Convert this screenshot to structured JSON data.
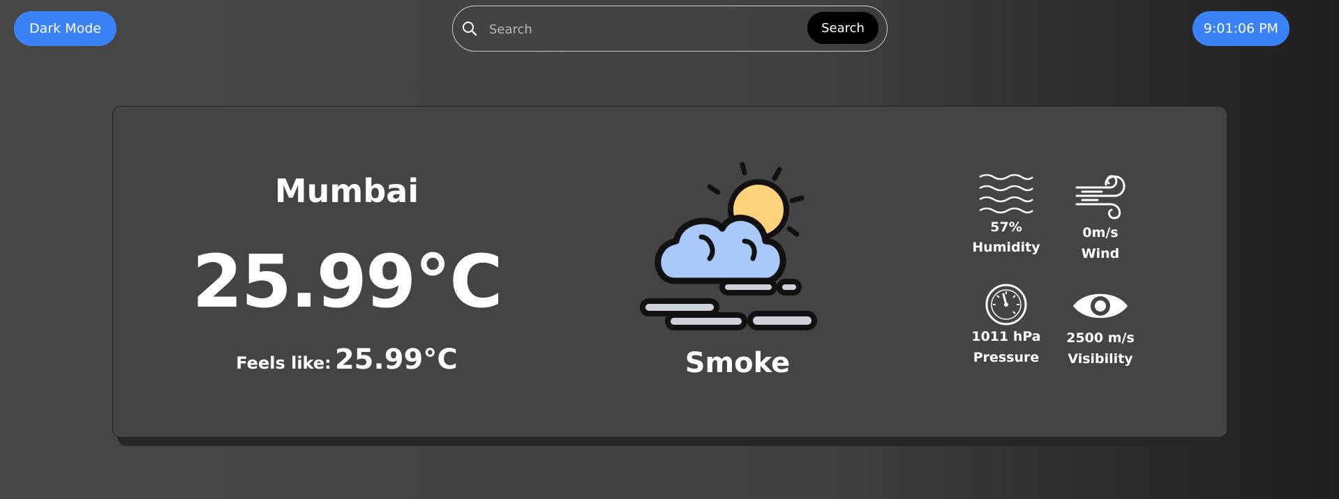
{
  "header": {
    "dark_mode_label": "Dark Mode",
    "search_placeholder": "Search",
    "search_button_label": "Search",
    "clock": "9:01:06 PM"
  },
  "weather": {
    "city": "Mumbai",
    "temperature": "25.99°C",
    "feels_like_label": "Feels like:",
    "feels_like_value": "25.99°C",
    "description": "Smoke",
    "icon": "cloud-sun-smoke-icon"
  },
  "stats": {
    "humidity": {
      "value": "57%",
      "label": "Humidity",
      "icon": "humidity-waves-icon"
    },
    "wind": {
      "value": "0m/s",
      "label": "Wind",
      "icon": "wind-icon"
    },
    "pressure": {
      "value": "1011 hPa",
      "label": "Pressure",
      "icon": "gauge-icon"
    },
    "visibility": {
      "value": "2500 m/s",
      "label": "Visibility",
      "icon": "eye-icon"
    }
  },
  "colors": {
    "accent": "#3b82f6",
    "card": "#444444",
    "background": "#464646"
  }
}
